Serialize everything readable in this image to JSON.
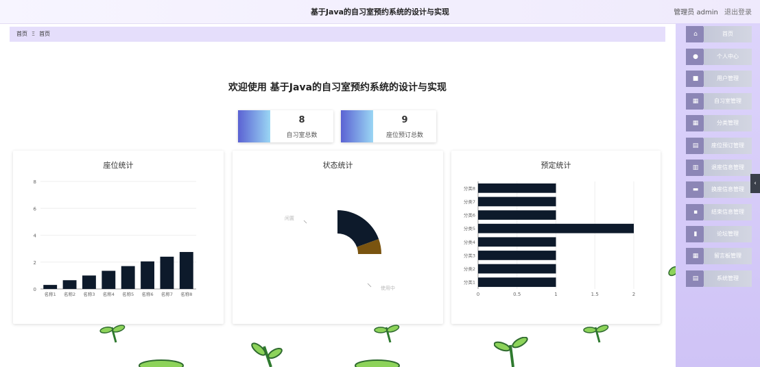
{
  "header": {
    "title": "基于Java的自习室预约系统的设计与实现",
    "user_role_name": "管理员 admin",
    "logout_label": "退出登录"
  },
  "breadcrumb": {
    "items": [
      "首页",
      "首页"
    ],
    "separator": "Ξ"
  },
  "welcome": "欢迎使用 基于Java的自习室预约系统的设计与实现",
  "stats": [
    {
      "value": "8",
      "label": "自习室总数"
    },
    {
      "value": "9",
      "label": "座位预订总数"
    }
  ],
  "sidebar": {
    "items": [
      {
        "label": "首页",
        "icon": "home-icon"
      },
      {
        "label": "个人中心",
        "icon": "user-icon"
      },
      {
        "label": "用户管理",
        "icon": "briefcase-icon"
      },
      {
        "label": "自习室管理",
        "icon": "grid-icon"
      },
      {
        "label": "分类管理",
        "icon": "grid-icon"
      },
      {
        "label": "座位预订管理",
        "icon": "document-icon"
      },
      {
        "label": "退座信息管理",
        "icon": "table-icon"
      },
      {
        "label": "换座信息管理",
        "icon": "card-icon"
      },
      {
        "label": "结束信息管理",
        "icon": "chat-icon"
      },
      {
        "label": "论坛管理",
        "icon": "bookmark-icon"
      },
      {
        "label": "留言板管理",
        "icon": "grid-icon"
      },
      {
        "label": "系统管理",
        "icon": "document-icon"
      }
    ]
  },
  "colors": {
    "bar": "#0d1a2b",
    "pie_in_use": "#0d1a2b",
    "pie_idle": "#7a5410",
    "sidebar_tab": "#8c86b6",
    "accent_gradient_start": "#5b62d3",
    "accent_gradient_end": "#9ad6f4"
  },
  "chart_data": [
    {
      "type": "bar",
      "title": "座位统计",
      "categories": [
        "名称1",
        "名称2",
        "名称3",
        "名称4",
        "名称5",
        "名称6",
        "名称7",
        "名称8"
      ],
      "values": [
        0.3,
        0.65,
        1.0,
        1.35,
        1.7,
        2.05,
        2.4,
        2.75
      ],
      "ylim": [
        0,
        8
      ],
      "yticks": [
        0,
        2,
        4,
        6,
        8
      ],
      "grid": true
    },
    {
      "type": "pie",
      "title": "状态统计",
      "slices": [
        {
          "label": "使用中",
          "value": 7
        },
        {
          "label": "闲置",
          "value": 2
        }
      ]
    },
    {
      "type": "bar",
      "orientation": "horizontal",
      "title": "预定统计",
      "categories": [
        "分类1",
        "分类2",
        "分类3",
        "分类4",
        "分类5",
        "分类6",
        "分类7",
        "分类8"
      ],
      "values": [
        1,
        1,
        1,
        1,
        2,
        1,
        1,
        1
      ],
      "xlim": [
        0,
        2
      ],
      "xticks": [
        "0",
        "0.5",
        "1",
        "1.5",
        "2"
      ],
      "grid": true
    }
  ]
}
